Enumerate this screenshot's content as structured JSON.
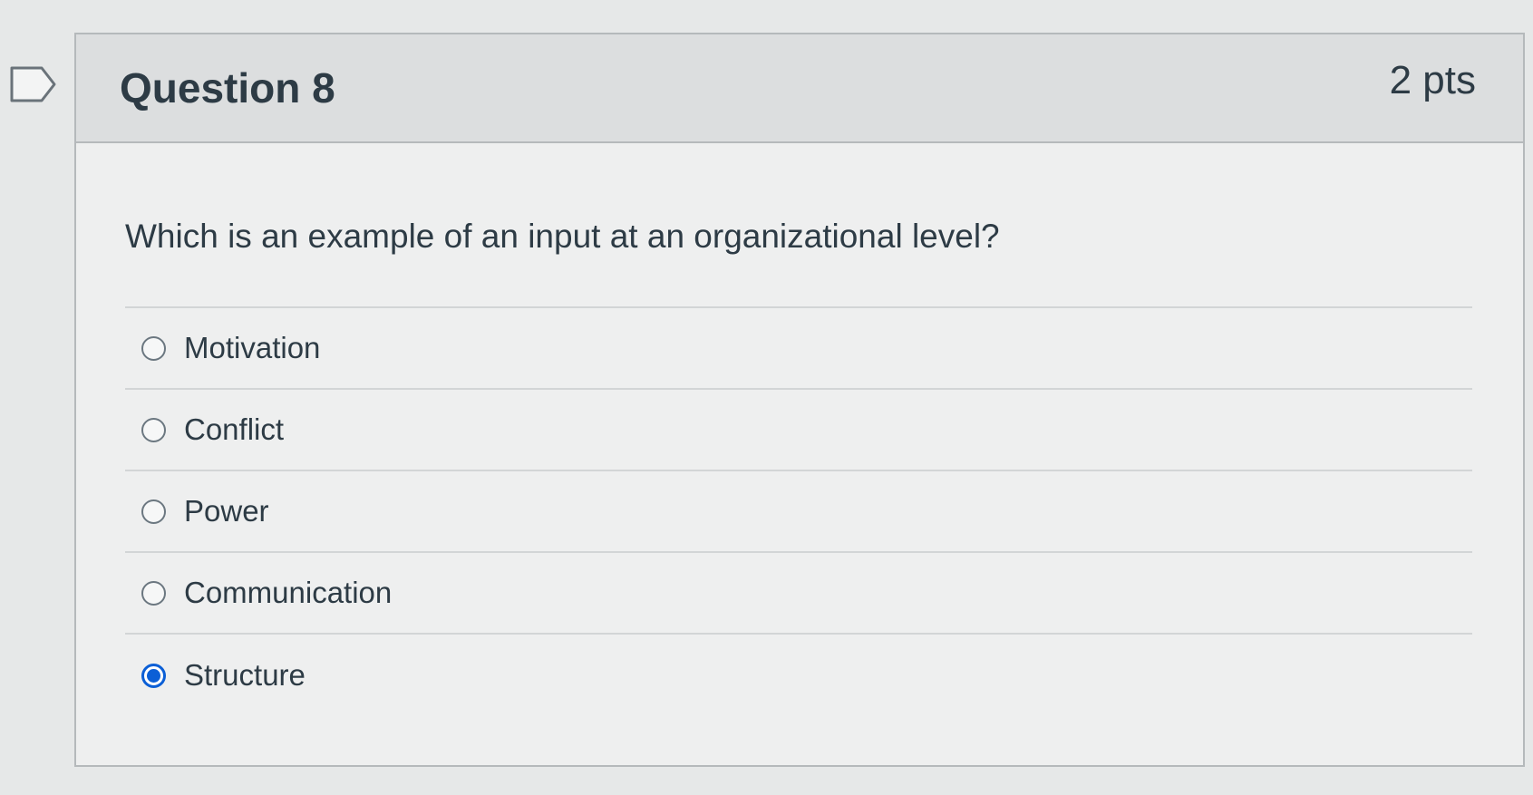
{
  "question": {
    "title": "Question 8",
    "points": "2 pts",
    "text": "Which is an example of an input at an organizational level?",
    "answers": [
      {
        "label": "Motivation",
        "selected": false
      },
      {
        "label": "Conflict",
        "selected": false
      },
      {
        "label": "Power",
        "selected": false
      },
      {
        "label": "Communication",
        "selected": false
      },
      {
        "label": "Structure",
        "selected": true
      }
    ]
  },
  "colors": {
    "selected_radio": "#0b5fd6",
    "text": "#2d3b45",
    "header_bg": "#dcdedf"
  },
  "icons": {
    "flag": "flag-icon"
  }
}
